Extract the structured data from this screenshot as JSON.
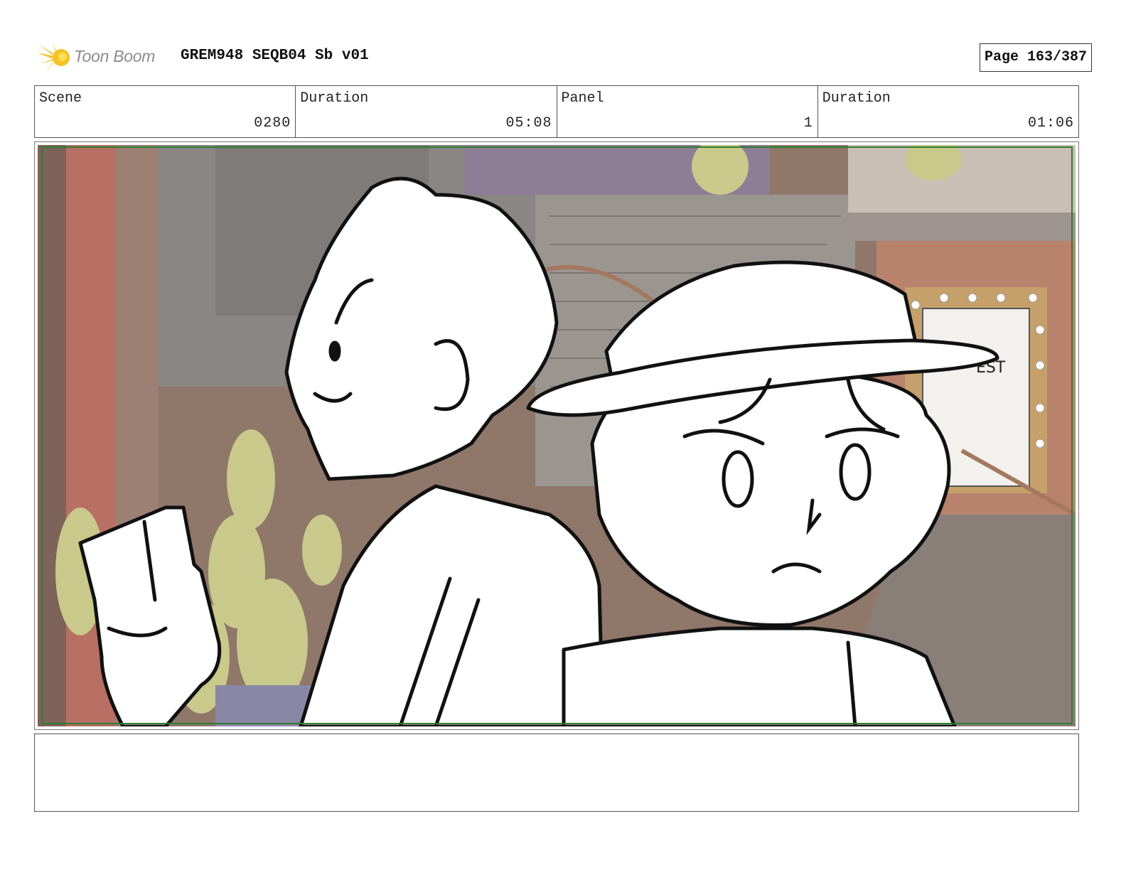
{
  "header": {
    "logo_text": "Toon Boom",
    "doc_title": "GREM948 SEQB04 Sb v01",
    "page_indicator": "Page 163/387"
  },
  "info": {
    "scene": {
      "label": "Scene",
      "value": "0280"
    },
    "scene_duration": {
      "label": "Duration",
      "value": "05:08"
    },
    "panel": {
      "label": "Panel",
      "value": "1"
    },
    "panel_duration": {
      "label": "Duration",
      "value": "01:06"
    }
  },
  "panel": {
    "poster_text": "EST"
  },
  "notes": {
    "text": ""
  },
  "colors": {
    "safe_frame": "#2e7d32",
    "logo_yellow": "#f6c324",
    "background_wall": "#8a6e60"
  }
}
